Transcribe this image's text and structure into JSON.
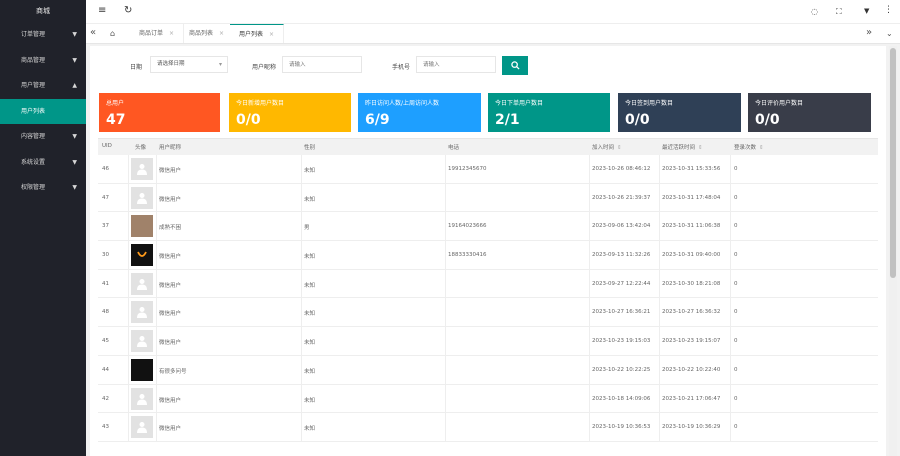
{
  "sidebar": {
    "logo": "商城",
    "items": [
      {
        "label": "订单管理",
        "caret": "▼"
      },
      {
        "label": "商品管理",
        "caret": "▼"
      },
      {
        "label": "用户管理",
        "caret": "▲"
      },
      {
        "label": "用户列表",
        "caret": ""
      },
      {
        "label": "内容管理",
        "caret": "▼"
      },
      {
        "label": "系统设置",
        "caret": "▼"
      },
      {
        "label": "权限管理",
        "caret": "▼"
      }
    ]
  },
  "tabs": [
    {
      "label": "商品订单",
      "close": "×"
    },
    {
      "label": "商品列表",
      "close": "×"
    },
    {
      "label": "用户列表",
      "close": "×"
    }
  ],
  "filter": {
    "date_label": "日期",
    "date_value": "请选择日期",
    "nickname_label": "用户昵称",
    "nickname_placeholder": "请输入",
    "phone_label": "手机号",
    "phone_placeholder": "请输入"
  },
  "cards": [
    {
      "title": "总用户",
      "value": "47",
      "color": "#ff5722"
    },
    {
      "title": "今日新增用户数目",
      "value": "0/0",
      "color": "#ffb800"
    },
    {
      "title": "昨日访问人数/上周访问人数",
      "value": "6/9",
      "color": "#1e9fff"
    },
    {
      "title": "今日下单用户数目",
      "value": "2/1",
      "color": "#009688"
    },
    {
      "title": "今日签到用户数目",
      "value": "0/0",
      "color": "#2f4056"
    },
    {
      "title": "今日评价用户数目",
      "value": "0/0",
      "color": "#393d49"
    }
  ],
  "table": {
    "headers": [
      "UID",
      "头像",
      "用户昵称",
      "性别",
      "电话",
      "加入时间",
      "最近活跃时间",
      "登录次数"
    ],
    "rows": [
      {
        "uid": "46",
        "avatar": "default",
        "nick": "微信用户",
        "gender": "未知",
        "phone": "19912345670",
        "join": "2023-10-26 08:46:12",
        "active": "2023-10-31 15:33:56",
        "count": "0"
      },
      {
        "uid": "47",
        "avatar": "default",
        "nick": "微信用户",
        "gender": "未知",
        "phone": "",
        "join": "2023-10-26 21:39:37",
        "active": "2023-10-31 17:48:04",
        "count": "0"
      },
      {
        "uid": "37",
        "avatar": "photo",
        "nick": "成熟不困",
        "gender": "男",
        "phone": "19164023666",
        "join": "2023-09-06 13:42:04",
        "active": "2023-10-31 11:06:38",
        "count": "0"
      },
      {
        "uid": "30",
        "avatar": "dark",
        "nick": "微信用户",
        "gender": "未知",
        "phone": "18833330416",
        "join": "2023-09-13 11:32:26",
        "active": "2023-10-31 09:40:00",
        "count": "0"
      },
      {
        "uid": "41",
        "avatar": "default",
        "nick": "微信用户",
        "gender": "未知",
        "phone": "",
        "join": "2023-09-27 12:22:44",
        "active": "2023-10-30 18:21:08",
        "count": "0"
      },
      {
        "uid": "48",
        "avatar": "default",
        "nick": "微信用户",
        "gender": "未知",
        "phone": "",
        "join": "2023-10-27 16:36:21",
        "active": "2023-10-27 16:36:32",
        "count": "0"
      },
      {
        "uid": "45",
        "avatar": "default",
        "nick": "微信用户",
        "gender": "未知",
        "phone": "",
        "join": "2023-10-23 19:15:03",
        "active": "2023-10-23 19:15:07",
        "count": "0"
      },
      {
        "uid": "44",
        "avatar": "dark",
        "nick": "有很多问号",
        "gender": "未知",
        "phone": "",
        "join": "2023-10-22 10:22:25",
        "active": "2023-10-22 10:22:40",
        "count": "0"
      },
      {
        "uid": "42",
        "avatar": "default",
        "nick": "微信用户",
        "gender": "未知",
        "phone": "",
        "join": "2023-10-18 14:09:06",
        "active": "2023-10-21 17:06:47",
        "count": "0"
      },
      {
        "uid": "43",
        "avatar": "default",
        "nick": "微信用户",
        "gender": "未知",
        "phone": "",
        "join": "2023-10-19 10:36:53",
        "active": "2023-10-19 10:36:29",
        "count": "0"
      }
    ]
  }
}
